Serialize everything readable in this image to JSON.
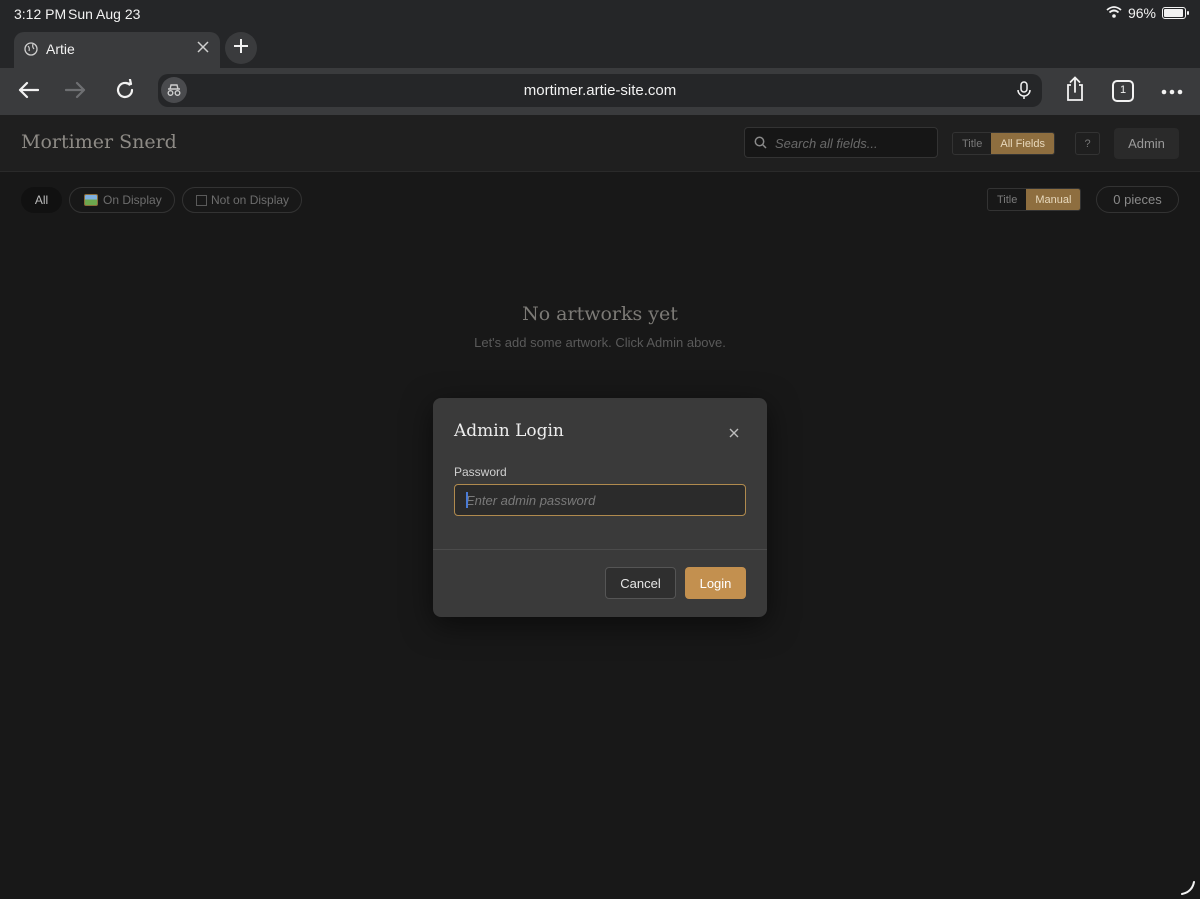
{
  "status": {
    "time": "3:12 PM",
    "date": "Sun Aug 23",
    "battery": "96%",
    "battery_level": 0.96
  },
  "browser": {
    "tab_title": "Artie",
    "url": "mortimer.artie-site.com",
    "tab_count": "1"
  },
  "header": {
    "site_title": "Mortimer Snerd",
    "search_placeholder": "Search all fields...",
    "search_scope": {
      "title": "Title",
      "all_fields": "All Fields",
      "selected": "All Fields"
    },
    "help_label": "?",
    "admin_label": "Admin"
  },
  "filters": {
    "all": "All",
    "on_display": "On Display",
    "not_on_display": "Not on Display",
    "selected": "All"
  },
  "sort": {
    "title": "Title",
    "manual": "Manual",
    "selected": "Manual"
  },
  "pieces_count": "0 pieces",
  "empty_state": {
    "title": "No artworks yet",
    "subtitle": "Let's add some artwork. Click Admin above."
  },
  "modal": {
    "title": "Admin Login",
    "password_label": "Password",
    "password_placeholder": "Enter admin password",
    "password_value": "",
    "cancel_label": "Cancel",
    "login_label": "Login"
  },
  "colors": {
    "accent": "#c3904f",
    "background": "#181818"
  },
  "icons": [
    "wifi-icon",
    "battery-icon",
    "globe-icon",
    "close-icon",
    "plus-icon",
    "back-arrow-icon",
    "forward-arrow-icon",
    "reload-icon",
    "privacy-icon",
    "microphone-icon",
    "share-icon",
    "tabs-icon",
    "more-icon",
    "search-icon",
    "picture-icon",
    "checkbox-icon"
  ]
}
